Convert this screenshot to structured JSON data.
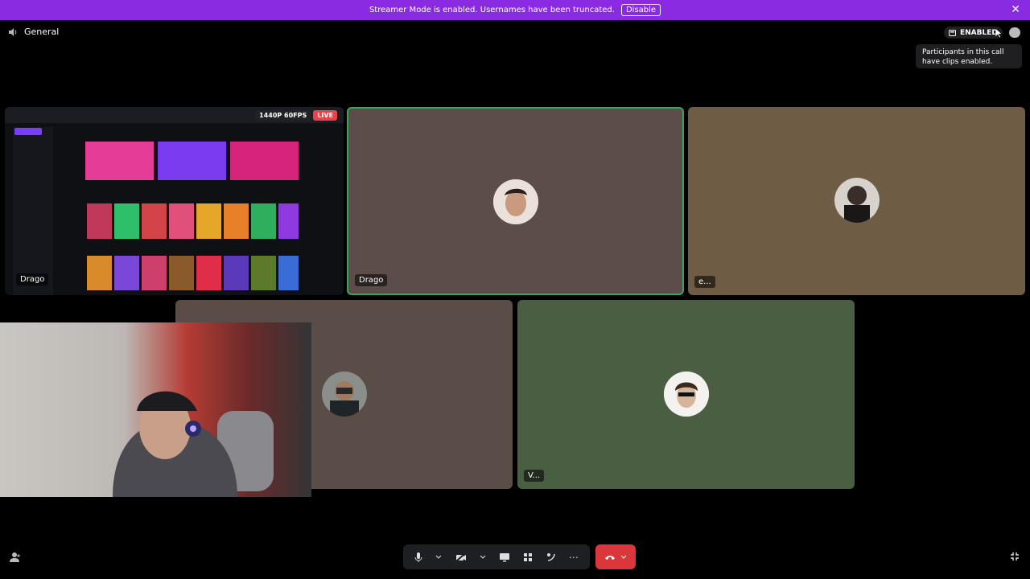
{
  "banner": {
    "text": "Streamer Mode is enabled. Usernames have been truncated.",
    "disable_label": "Disable",
    "close_glyph": "✕"
  },
  "channel": {
    "icon": "speaker-icon",
    "name": "General"
  },
  "clips": {
    "status_label": "ENABLED",
    "tooltip": "Participants in this call have clips enabled."
  },
  "tiles": {
    "stream": {
      "name": "Drago",
      "quality": "1440P 60FPS",
      "live": "LIVE"
    },
    "drago": {
      "name": "Drago",
      "bg": "#5c4d4a",
      "border": "#3ba55c"
    },
    "e": {
      "name": "e...",
      "bg": "#6e5c44"
    },
    "third": {
      "bg": "#5a4d48"
    },
    "v": {
      "name": "V...",
      "bg": "#4a5e42"
    }
  },
  "controls": {
    "mic": "mic-icon",
    "camera": "camera-off-icon",
    "screen": "screen-share-icon",
    "activities": "activities-icon",
    "soundboard": "soundboard-icon",
    "more": "⋯",
    "hangup": "hang-up-icon"
  }
}
